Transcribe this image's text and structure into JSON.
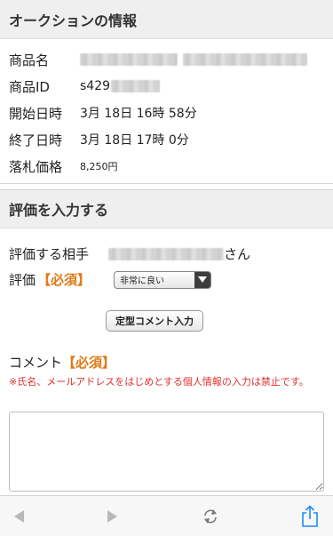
{
  "auction": {
    "header": "オークションの情報",
    "item_name_label": "商品名",
    "item_id_label": "商品ID",
    "item_id_value": "s429",
    "start_label": "開始日時",
    "start_value": "3月 18日 16時 58分",
    "end_label": "終了日時",
    "end_value": "3月 18日 17時 0分",
    "price_label": "落札価格",
    "price_value": "8,250円"
  },
  "evaluation": {
    "header": "評価を入力する",
    "partner_label": "評価する相手",
    "partner_suffix": "さん",
    "rating_label": "評価",
    "required": "【必須】",
    "rating_selected": "非常に良い",
    "template_button": "定型コメント入力",
    "comment_label": "コメント",
    "warning": "※氏名、メールアドレスをはじめとする個人情報の入力は禁止です。"
  },
  "toolbar": {
    "icons": [
      "back-icon",
      "forward-icon",
      "reload-icon",
      "share-icon"
    ],
    "accent": "#1a8cf0"
  }
}
